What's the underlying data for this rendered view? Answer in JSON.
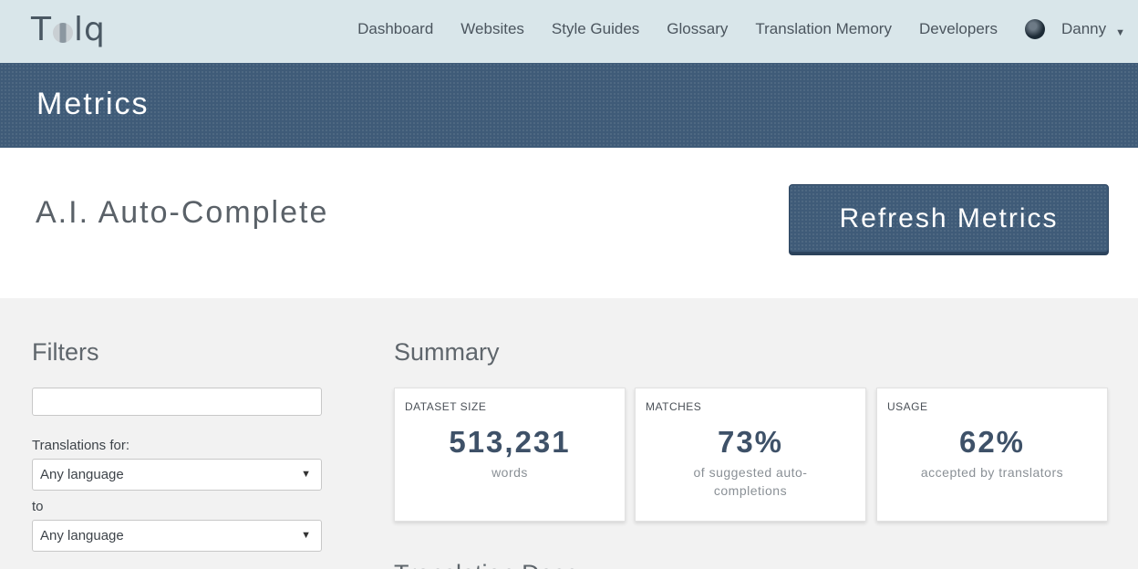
{
  "nav": {
    "logo": "Tolq",
    "links": [
      "Dashboard",
      "Websites",
      "Style Guides",
      "Glossary",
      "Translation Memory",
      "Developers"
    ],
    "user_name": "Danny",
    "icons": {
      "avatar": "avatar-icon",
      "caret": "caret-down-icon"
    }
  },
  "band": {
    "title": "Metrics"
  },
  "page": {
    "subtitle": "A.I. Auto-Complete",
    "refresh_label": "Refresh Metrics"
  },
  "filters": {
    "title": "Filters",
    "search_value": "",
    "translations_for_label": "Translations for:",
    "from_language": "Any language",
    "to_label": "to",
    "to_language": "Any language"
  },
  "summary": {
    "title": "Summary",
    "cards": [
      {
        "label": "DATASET SIZE",
        "value": "513,231",
        "desc": "words"
      },
      {
        "label": "MATCHES",
        "value": "73%",
        "desc": "of suggested auto-completions"
      },
      {
        "label": "USAGE",
        "value": "62%",
        "desc": "accepted by translators"
      }
    ]
  },
  "next_section": {
    "title": "Translation Desc..."
  },
  "colors": {
    "brand": "#3f5b78",
    "nav_bg": "#d9e6ea",
    "content_bg": "#f2f2f2"
  }
}
